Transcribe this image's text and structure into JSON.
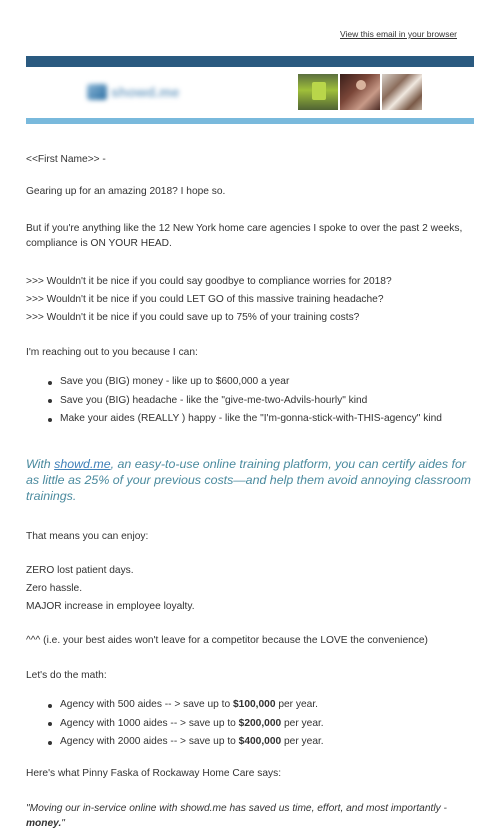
{
  "top": {
    "browser_link": "View this email in your browser"
  },
  "header": {
    "logo_text": "showd.me"
  },
  "body": {
    "greeting": "<<First Name>> -",
    "intro": "Gearing up for an amazing 2018? I hope so.",
    "para2": "But if you're anything like the 12 New York home care agencies I spoke to over the past 2 weeks, compliance is ON YOUR HEAD.",
    "wouldnt": [
      ">>> Wouldn't it be nice if you could say goodbye to compliance worries for 2018?",
      ">>> Wouldn't it be nice if you could LET GO of this massive training headache?",
      ">>> Wouldn't it be nice if you could save up to 75% of your training costs?"
    ],
    "reaching": "I'm reaching out to you because I can:",
    "benefits": [
      "Save you (BIG) money - like up to $600,000 a year",
      "Save you (BIG) headache - like the \"give-me-two-Advils-hourly\" kind",
      "Make your aides (REALLY ) happy - like the \"I'm-gonna-stick-with-THIS-agency\" kind"
    ],
    "highlight": {
      "prefix": "With ",
      "link": "showd.me",
      "suffix": ", an easy-to-use online training platform, you can certify aides for as little as 25% of your previous costs—and help them avoid annoying classroom trainings."
    },
    "enjoy": "That means you can enjoy:",
    "enjoy_lines": [
      "ZERO lost patient days.",
      "Zero hassle.",
      "MAJOR increase in employee loyalty."
    ],
    "caret_note": "^^^ (i.e. your best aides won't leave for a competitor because the LOVE the convenience)",
    "math_title": "Let's do the math:",
    "math": [
      {
        "label": "Agency with 500 aides   -- > save up to ",
        "amount": "$100,000",
        "suffix": " per year."
      },
      {
        "label": "Agency with 1000 aides -- > save up to ",
        "amount": "$200,000",
        "suffix": " per year."
      },
      {
        "label": "Agency with 2000 aides -- > save up to ",
        "amount": "$400,000",
        "suffix": " per year."
      }
    ],
    "testimonial_intro": "Here's what Pinny Faska of Rockaway Home Care says:",
    "quote": {
      "text": "\"Moving our in-service online with showd.me has saved us time, effort, and most importantly - ",
      "bold": "money.",
      "end": "\""
    }
  }
}
